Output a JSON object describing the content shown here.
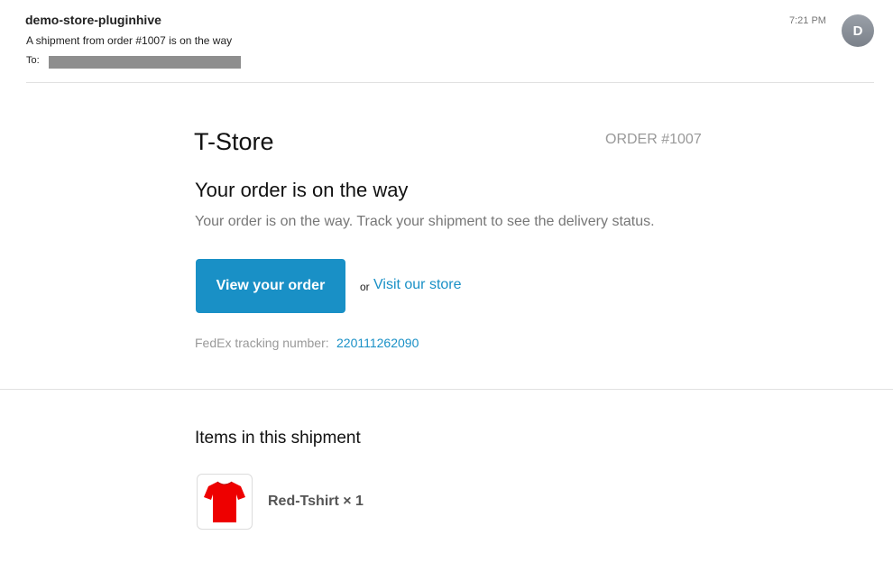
{
  "email": {
    "sender": "demo-store-pluginhive",
    "subject": "A shipment from order #1007 is on the way",
    "to_label": "To:",
    "time": "7:21 PM",
    "avatar_initial": "D"
  },
  "content": {
    "store_name": "T-Store",
    "order_number": "ORDER #1007",
    "headline": "Your order is on the way",
    "message": "Your order is on the way. Track your shipment to see the delivery status.",
    "view_order_label": "View your order",
    "or_text": "or",
    "visit_store_label": "Visit our store",
    "tracking_label": "FedEx tracking number:",
    "tracking_number": "220111262090"
  },
  "shipment": {
    "heading": "Items in this shipment",
    "items": [
      {
        "name": "Red-Tshirt × 1",
        "icon": "tshirt-icon",
        "color": "#ee0000"
      }
    ]
  },
  "colors": {
    "accent": "#1990c6",
    "muted_text": "#999999",
    "avatar_bg": "#8a9099"
  }
}
